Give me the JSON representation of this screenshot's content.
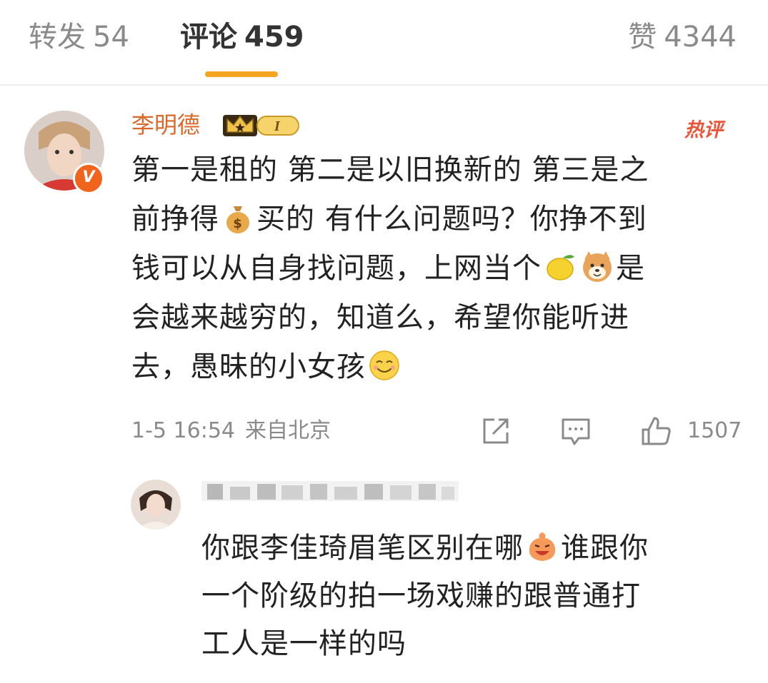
{
  "tabs": {
    "repost": {
      "label": "转发",
      "count": "54"
    },
    "comments": {
      "label": "评论",
      "count": "459"
    },
    "likes": {
      "label": "赞",
      "count": "4344"
    }
  },
  "comment": {
    "username": "李明德",
    "badge_level": "I",
    "hot_tag": "热评",
    "text_line1": "第一是租的 第二是以旧换新的 第三是之",
    "text_line2a": "前挣得",
    "text_line2b": "买的 有什么问题吗？你挣不到",
    "text_line3a": "钱可以从自身找问题，上网当个",
    "text_line3b": "是",
    "text_line4": "会越来越穷的，知道么，希望你能听进",
    "text_line5": "去，愚昧的小女孩",
    "timestamp": "1-5 16:54",
    "location": "来自北京",
    "like_count": "1507"
  },
  "reply": {
    "text_a": "你跟李佳琦眉笔区别在哪",
    "text_b": "谁跟你",
    "text_c": "一个阶级的拍一场戏赚的跟普通打",
    "text_d": "工人是一样的吗"
  },
  "icons": {
    "crown": "crown-icon",
    "money_bag": "money-bag-emoji",
    "lemon": "lemon-emoji",
    "dog": "doge-emoji",
    "smile": "smile-emoji",
    "laugh": "laugh-emoji",
    "share": "share-icon",
    "comment": "comment-icon",
    "like": "thumbs-up-icon",
    "verified": "verified-v-icon"
  },
  "colors": {
    "accent": "#f4a623",
    "username": "#d8692a",
    "hot": "#e8553b",
    "muted": "#8a8a8a",
    "verified": "#f0641e"
  }
}
